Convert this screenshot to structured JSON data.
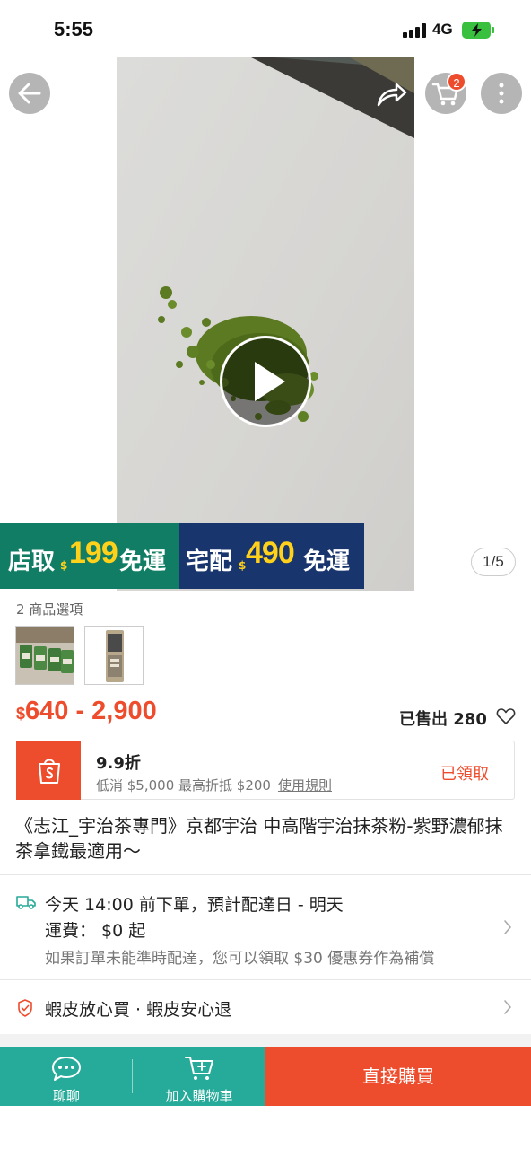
{
  "status_bar": {
    "time": "5:55",
    "network": "4G"
  },
  "top_actions": {
    "cart_count": "2"
  },
  "media": {
    "image_counter": "1/5",
    "current_index": 1,
    "total_images": 5
  },
  "promo": {
    "pickup": {
      "label": "店取",
      "currency": "$",
      "amount": "199",
      "suffix": "免運"
    },
    "home": {
      "label": "宅配",
      "currency": "$",
      "amount": "490",
      "suffix": "免運"
    }
  },
  "variants": {
    "label": "2 商品選項"
  },
  "price": {
    "currency": "$",
    "range": "640 - 2,900"
  },
  "sold": {
    "text": "已售出 280"
  },
  "voucher": {
    "title": "9.9折",
    "description": "低消 $5,000 最高折抵 $200",
    "rules_link": "使用規則",
    "status": "已領取"
  },
  "product": {
    "title": "《志江_宇治茶專門》京都宇治 中高階宇治抹茶粉-紫野濃郁抹茶拿鐵最適用～"
  },
  "shipping": {
    "delivery": "今天 14:00 前下單，預計配達日 - 明天",
    "fee": "運費： $0 起",
    "guarantee_note": "如果訂單未能準時配達，您可以領取 $30 優惠券作為補償"
  },
  "guarantee": {
    "text": "蝦皮放心買 · 蝦皮安心退"
  },
  "bottom_bar": {
    "chat": "聊聊",
    "add_to_cart": "加入購物車",
    "buy_now": "直接購買"
  },
  "colors": {
    "brand_orange": "#ee4d2d",
    "teal": "#26aa99",
    "pickup_green": "#117d64",
    "home_navy": "#19356e",
    "promo_yellow": "#ffd11a"
  },
  "icons": [
    "back-arrow-icon",
    "share-icon",
    "cart-icon",
    "more-vertical-icon",
    "play-icon",
    "heart-icon",
    "shopee-bag-icon",
    "truck-icon",
    "shield-check-icon",
    "chevron-right-icon",
    "chat-bubble-icon",
    "add-cart-icon"
  ]
}
